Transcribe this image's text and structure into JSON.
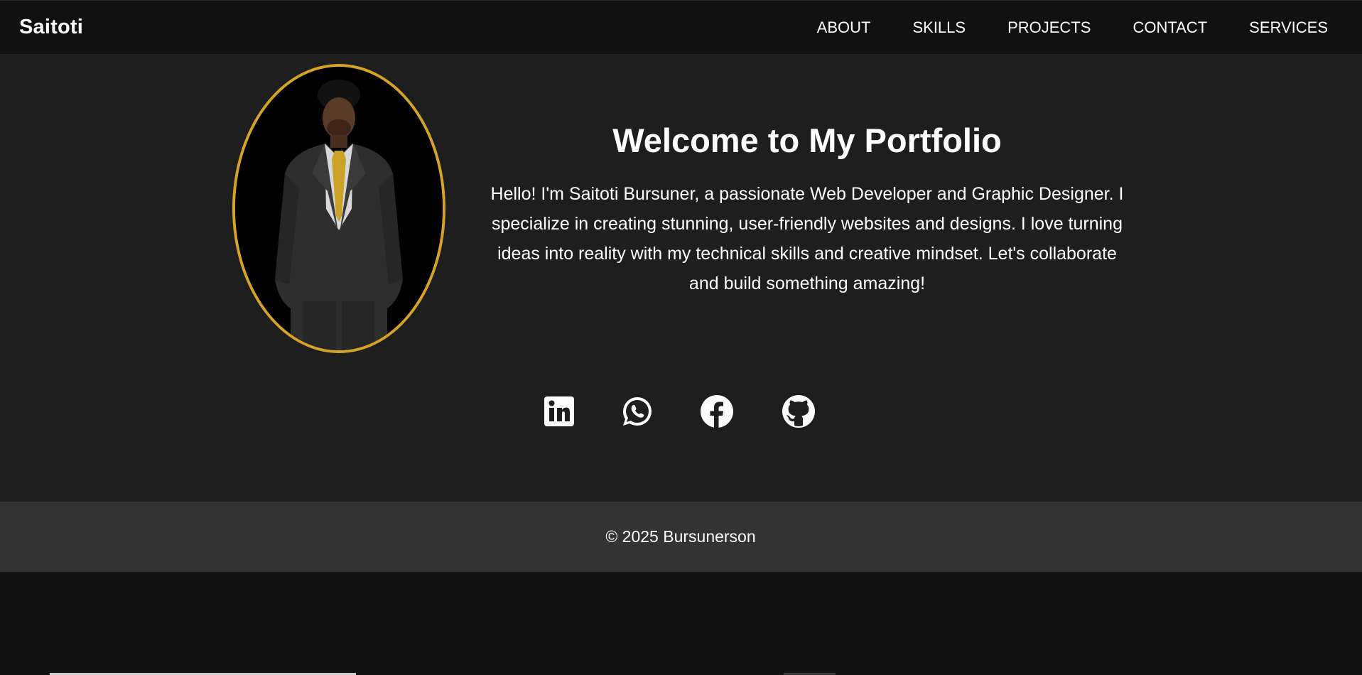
{
  "header": {
    "brand": "Saitoti",
    "nav": [
      {
        "label": "ABOUT"
      },
      {
        "label": "SKILLS"
      },
      {
        "label": "PROJECTS"
      },
      {
        "label": "CONTACT"
      },
      {
        "label": "SERVICES"
      }
    ]
  },
  "hero": {
    "title": "Welcome to My Portfolio",
    "description": "Hello! I'm Saitoti Bursuner, a passionate Web Developer and Graphic Designer. I specialize in creating stunning, user-friendly websites and designs. I love turning ideas into reality with my technical skills and creative mindset. Let's collaborate and build something amazing!",
    "portrait_icon": "profile-photo",
    "accent_color": "#d4a327"
  },
  "socials": [
    {
      "icon": "linkedin-icon"
    },
    {
      "icon": "whatsapp-icon"
    },
    {
      "icon": "facebook-icon"
    },
    {
      "icon": "github-icon"
    }
  ],
  "footer": {
    "copyright": "© 2025 Bursunerson"
  },
  "colors": {
    "nav_bg": "#111111",
    "hero_bg": "#1e1e1e",
    "footer_bg": "#333333"
  }
}
